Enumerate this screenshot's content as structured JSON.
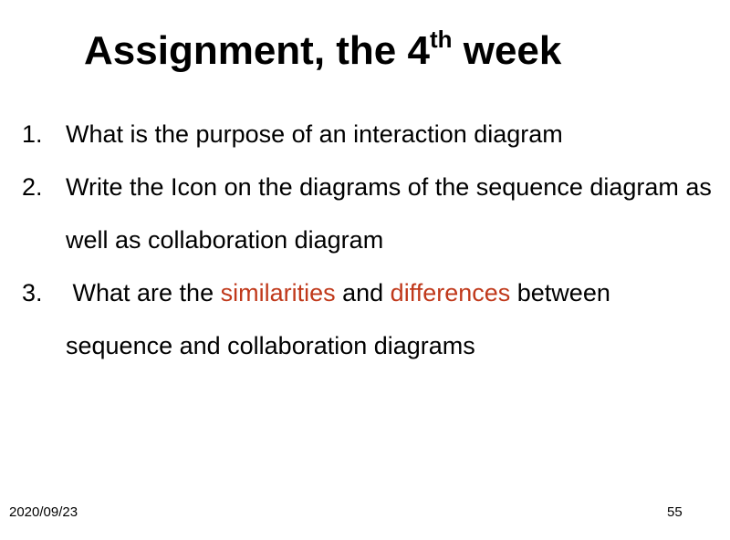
{
  "slide": {
    "title_text": "Assignment, the 4",
    "title_superscript": "th",
    "title_suffix": " week"
  },
  "items": [
    {
      "number": "1.",
      "text": "What is the purpose of an interaction diagram"
    },
    {
      "number": "2.",
      "text": "Write the Icon on the diagrams  of the sequence diagram as well as collaboration diagram"
    },
    {
      "number": "3.",
      "text_prefix": " What are the ",
      "highlight_1": "similarities",
      "text_middle": " and ",
      "highlight_2": "differences",
      "text_suffix": " between sequence and collaboration diagrams"
    }
  ],
  "footer": {
    "date": "2020/09/23",
    "page_number": "55"
  },
  "colors": {
    "highlight": "#c0391b",
    "text": "#000000",
    "background": "#ffffff"
  }
}
